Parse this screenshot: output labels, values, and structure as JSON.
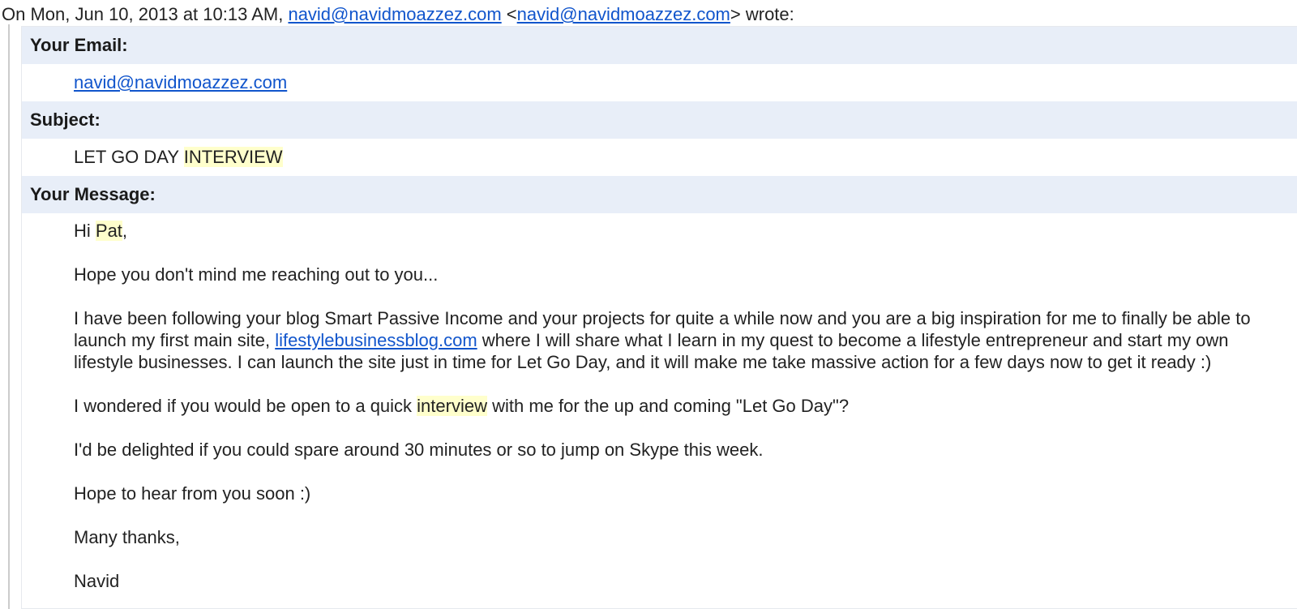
{
  "attribution": {
    "prefix": "On Mon, Jun 10, 2013 at 10:13 AM, ",
    "sender_link": "navid@navidmoazzez.com",
    "angle_open": " <",
    "sender_email_link": "navid@navidmoazzez.com",
    "suffix": "> wrote:"
  },
  "form": {
    "email_label": "Your Email:",
    "email_value": "navid@navidmoazzez.com",
    "subject_label": "Subject:",
    "subject_prefix": "LET GO DAY ",
    "subject_highlight": "INTERVIEW",
    "message_label": "Your Message:"
  },
  "message": {
    "greeting_prefix": "Hi ",
    "greeting_name": "Pat",
    "greeting_suffix": ",",
    "p1": "Hope you don't mind me reaching out to you...",
    "p2_before": "I have been following your blog Smart Passive Income and your projects for quite a while now and you are a big inspiration for me to finally be able to launch my first main site, ",
    "p2_link": "lifestylebusinessblog.com",
    "p2_after": " where I will share what I learn in my quest to become a lifestyle entrepreneur and start my own lifestyle businesses. I can launch the site just in time for Let Go Day, and it will make me take massive action for a few days now to get it ready :)",
    "p3_before": "I wondered if you would be open to a quick ",
    "p3_highlight": "interview",
    "p3_after": " with me for the up and coming \"Let Go Day\"?",
    "p4": "I'd be delighted if you could spare around 30 minutes or so to jump on Skype this week.",
    "p5": "Hope to hear from you soon :)",
    "closing": "Many thanks,",
    "signature": "Navid"
  },
  "colors": {
    "link": "#1155cc",
    "highlight": "#ffffcc",
    "label_background": "#e8eef8",
    "quote_border": "#cccccc"
  }
}
